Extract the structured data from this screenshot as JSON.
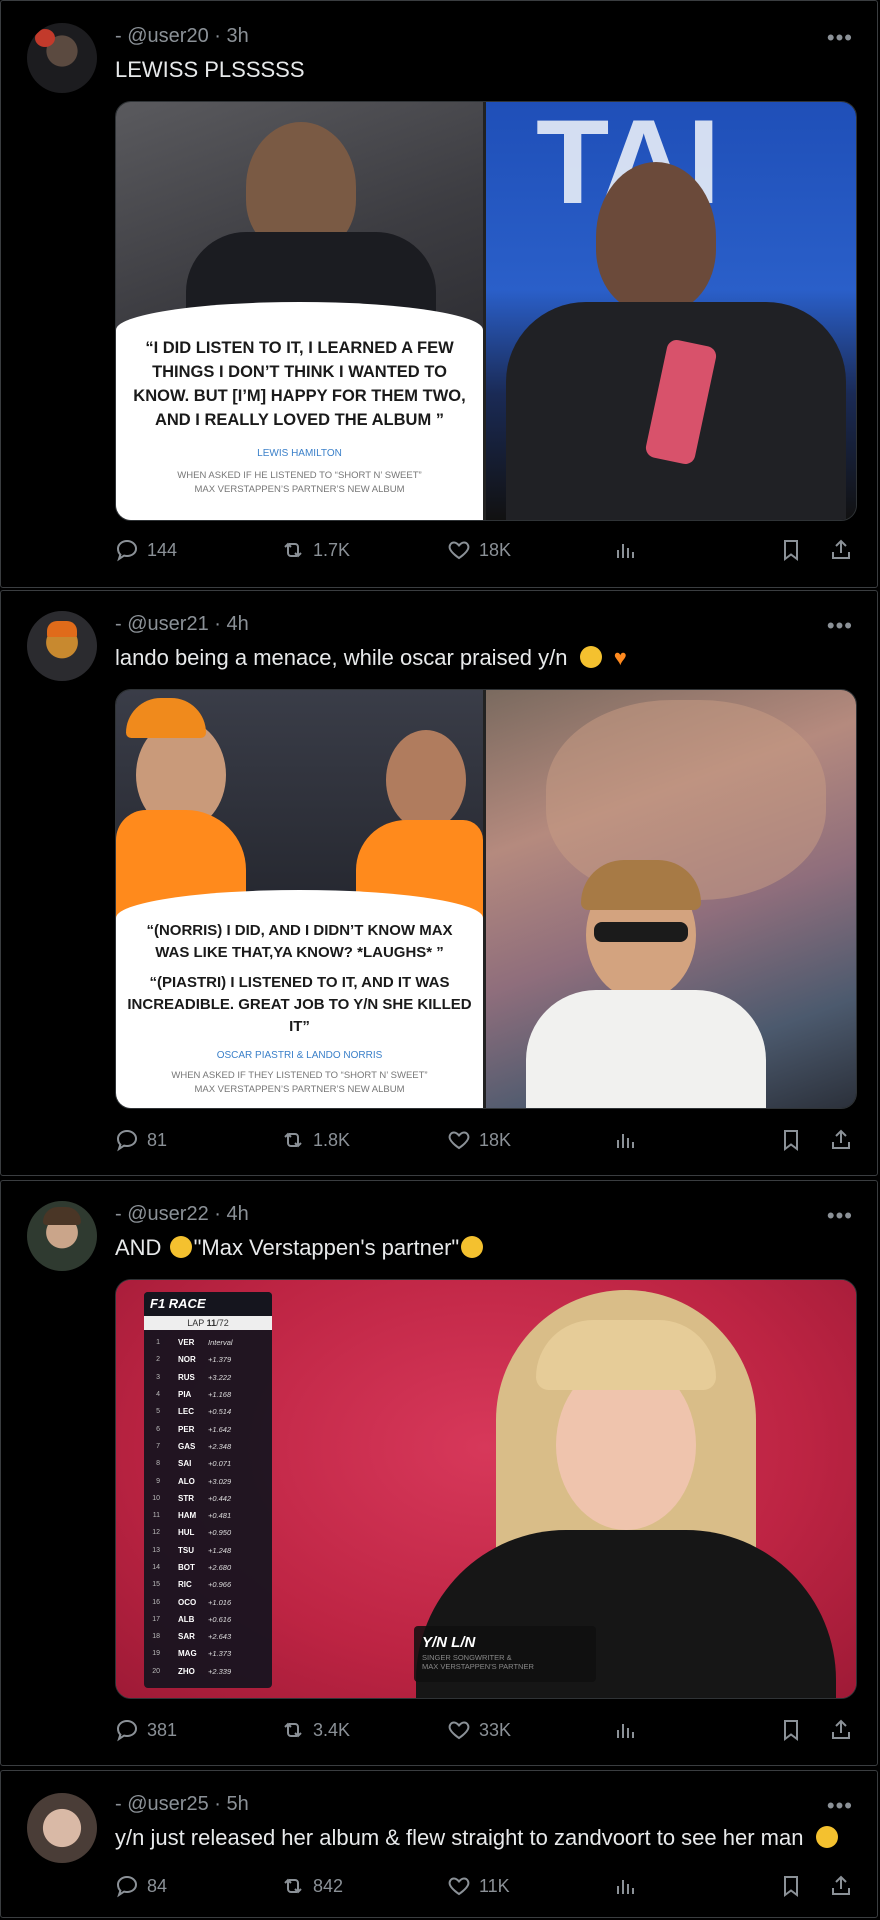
{
  "posts": [
    {
      "user": "@user20",
      "time": "3h",
      "text": "LEWISS PLSSSSS",
      "quote": {
        "lines": [
          "“I DID LISTEN TO IT, I LEARNED A FEW",
          "THINGS I DON’T THINK I WANTED TO",
          "KNOW. BUT [I’M] HAPPY FOR THEM TWO,",
          "AND I REALLY LOVED THE ALBUM ”"
        ],
        "source": "LEWIS HAMILTON",
        "context": [
          "WHEN ASKED IF HE LISTENED TO “SHORT N’ SWEET”",
          "MAX VERSTAPPEN’S PARTNER’S NEW ALBUM"
        ]
      },
      "stats": {
        "replies": "144",
        "reposts": "1.7K",
        "likes": "18K"
      }
    },
    {
      "user": "@user21",
      "time": "4h",
      "text": "lando being a menace, while oscar praised y/n",
      "quote": {
        "lines": [
          "“(NORRIS) I DID, AND I DIDN’T KNOW MAX",
          "WAS LIKE THAT,YA KNOW? *LAUGHS* ”",
          "“(PIASTRI) I LISTENED TO IT, AND IT WAS",
          "INCREADIBLE. GREAT JOB TO Y/N SHE KILLED IT”"
        ],
        "source": "OSCAR PIASTRI & LANDO NORRIS",
        "context": [
          "WHEN ASKED IF THEY LISTENED TO “SHORT N’ SWEET”",
          "MAX VERSTAPPEN’S PARTNER’S NEW ALBUM"
        ]
      },
      "stats": {
        "replies": "81",
        "reposts": "1.8K",
        "likes": "18K"
      }
    },
    {
      "user": "@user22",
      "time": "4h",
      "text_a": "AND",
      "text_b": "\"Max Verstappen's partner\"",
      "tower": {
        "brand": "F1 RACE",
        "lap_label": "LAP",
        "lap": "11",
        "lap_total": "/72",
        "rows": [
          [
            "1",
            "VER",
            "Interval"
          ],
          [
            "2",
            "NOR",
            "+1.379"
          ],
          [
            "3",
            "RUS",
            "+3.222"
          ],
          [
            "4",
            "PIA",
            "+1.168"
          ],
          [
            "5",
            "LEC",
            "+0.514"
          ],
          [
            "6",
            "PER",
            "+1.642"
          ],
          [
            "7",
            "GAS",
            "+2.348"
          ],
          [
            "8",
            "SAI",
            "+0.071"
          ],
          [
            "9",
            "ALO",
            "+3.029"
          ],
          [
            "10",
            "STR",
            "+0.442"
          ],
          [
            "11",
            "HAM",
            "+0.481"
          ],
          [
            "12",
            "HUL",
            "+0.950"
          ],
          [
            "13",
            "TSU",
            "+1.248"
          ],
          [
            "14",
            "BOT",
            "+2.680"
          ],
          [
            "15",
            "RIC",
            "+0.966"
          ],
          [
            "16",
            "OCO",
            "+1.016"
          ],
          [
            "17",
            "ALB",
            "+0.616"
          ],
          [
            "18",
            "SAR",
            "+2.643"
          ],
          [
            "19",
            "MAG",
            "+1.373"
          ],
          [
            "20",
            "ZHO",
            "+2.339"
          ]
        ]
      },
      "lower_third": {
        "name": "Y/N L/N",
        "line1": "SINGER SONGWRITER &",
        "line2": "MAX VERSTAPPEN'S PARTNER"
      },
      "stats": {
        "replies": "381",
        "reposts": "3.4K",
        "likes": "33K"
      }
    },
    {
      "user": "@user25",
      "time": "5h",
      "text": "y/n just released her album & flew straight to zandvoort to see her man",
      "stats": {
        "replies": "84",
        "reposts": "842",
        "likes": "11K"
      }
    }
  ],
  "sep": "·",
  "dash": "-",
  "more": "•••",
  "colors": {
    "bg": "#000000",
    "muted": "#8b9197",
    "text": "#e7e9ea",
    "link": "#3b80c9"
  }
}
